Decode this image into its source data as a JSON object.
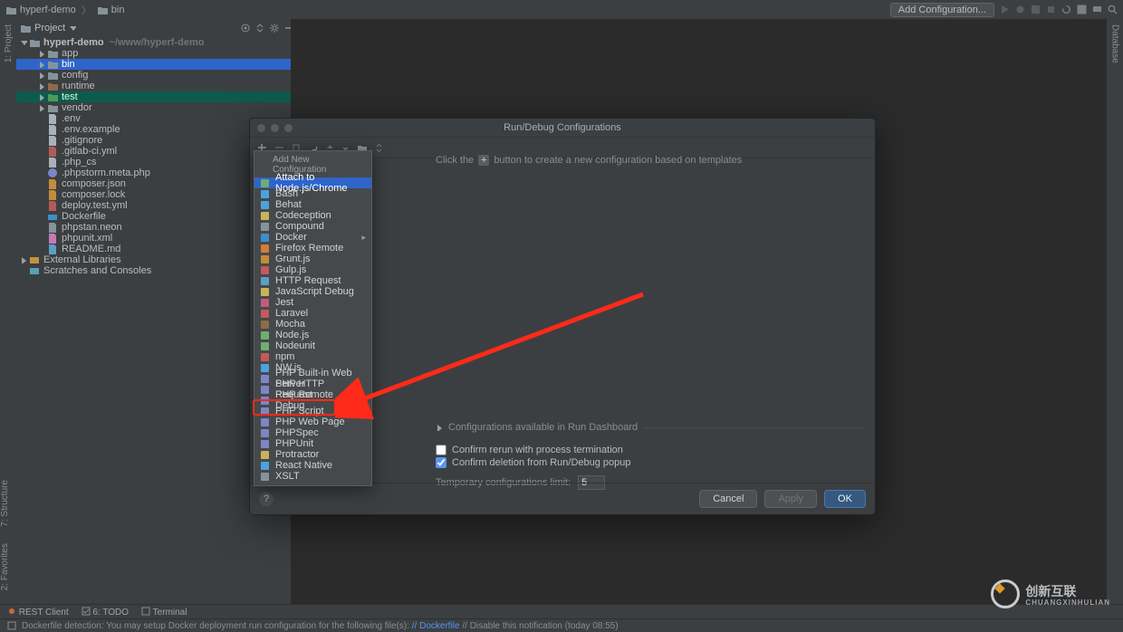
{
  "breadcrumbs": {
    "root": "hyperf-demo",
    "child": "bin"
  },
  "toolbar": {
    "add_config": "Add Configuration..."
  },
  "project_panel": {
    "title": "Project"
  },
  "left_strip": {
    "project": "1: Project",
    "structure": "7: Structure",
    "favorites": "2: Favorites"
  },
  "right_strip": {
    "database": "Database"
  },
  "tree": {
    "project_name": "hyperf-demo",
    "project_path": "~/www/hyperf-demo",
    "nodes": [
      {
        "label": "app",
        "type": "folder",
        "depth": 2,
        "expandable": true,
        "sel": ""
      },
      {
        "label": "bin",
        "type": "folder",
        "depth": 2,
        "expandable": true,
        "sel": "blue"
      },
      {
        "label": "config",
        "type": "folder",
        "depth": 2,
        "expandable": true,
        "sel": ""
      },
      {
        "label": "runtime",
        "type": "folder-ex",
        "depth": 2,
        "expandable": true,
        "sel": ""
      },
      {
        "label": "test",
        "type": "folder-g",
        "depth": 2,
        "expandable": true,
        "sel": "teal"
      },
      {
        "label": "vendor",
        "type": "folder",
        "depth": 2,
        "expandable": true,
        "sel": ""
      },
      {
        "label": ".env",
        "type": "file",
        "depth": 2,
        "expandable": false
      },
      {
        "label": ".env.example",
        "type": "file",
        "depth": 2,
        "expandable": false
      },
      {
        "label": ".gitignore",
        "type": "file",
        "depth": 2,
        "expandable": false
      },
      {
        "label": ".gitlab-ci.yml",
        "type": "yml",
        "depth": 2,
        "expandable": false
      },
      {
        "label": ".php_cs",
        "type": "file",
        "depth": 2,
        "expandable": false
      },
      {
        "label": ".phpstorm.meta.php",
        "type": "php",
        "depth": 2,
        "expandable": false
      },
      {
        "label": "composer.json",
        "type": "json",
        "depth": 2,
        "expandable": false
      },
      {
        "label": "composer.lock",
        "type": "json",
        "depth": 2,
        "expandable": false
      },
      {
        "label": "deploy.test.yml",
        "type": "yml",
        "depth": 2,
        "expandable": false
      },
      {
        "label": "Dockerfile",
        "type": "docker",
        "depth": 2,
        "expandable": false
      },
      {
        "label": "phpstan.neon",
        "type": "neon",
        "depth": 2,
        "expandable": false
      },
      {
        "label": "phpunit.xml",
        "type": "xml",
        "depth": 2,
        "expandable": false
      },
      {
        "label": "README.md",
        "type": "md",
        "depth": 2,
        "expandable": false
      }
    ],
    "external": "External Libraries",
    "scratches": "Scratches and Consoles"
  },
  "modal": {
    "title": "Run/Debug Configurations",
    "hint_before": "Click the",
    "hint_after": "button to create a new configuration based on templates",
    "dashboard_label": "Configurations available in Run Dashboard",
    "confirm_rerun": "Confirm rerun with process termination",
    "confirm_delete": "Confirm deletion from Run/Debug popup",
    "temp_label": "Temporary configurations limit:",
    "temp_value": "5",
    "cancel": "Cancel",
    "apply": "Apply",
    "ok": "OK",
    "popup_head": "Add New Configuration",
    "popup_items": [
      "Attach to Node.js/Chrome",
      "Bash",
      "Behat",
      "Codeception",
      "Compound",
      "Docker",
      "Firefox Remote",
      "Grunt.js",
      "Gulp.js",
      "HTTP Request",
      "JavaScript Debug",
      "Jest",
      "Laravel",
      "Mocha",
      "Node.js",
      "Nodeunit",
      "npm",
      "NW.js",
      "PHP Built-in Web Server",
      "PHP HTTP Request",
      "PHP Remote Debug",
      "PHP Script",
      "PHP Web Page",
      "PHPSpec",
      "PHPUnit",
      "Protractor",
      "React Native",
      "XSLT"
    ],
    "popup_selected": 0,
    "popup_submenu_index": 5
  },
  "bottom_tools": {
    "rest": "REST Client",
    "todo": "6: TODO",
    "terminal": "Terminal"
  },
  "status": {
    "prefix": "Dockerfile detection: You may setup Docker deployment run configuration for the following file(s): ",
    "link": "// Dockerfile",
    "suffix": " // Disable this notification (today 08:55)"
  },
  "watermark": {
    "big": "创新互联",
    "small": "CHUANGXINHULIAN"
  }
}
